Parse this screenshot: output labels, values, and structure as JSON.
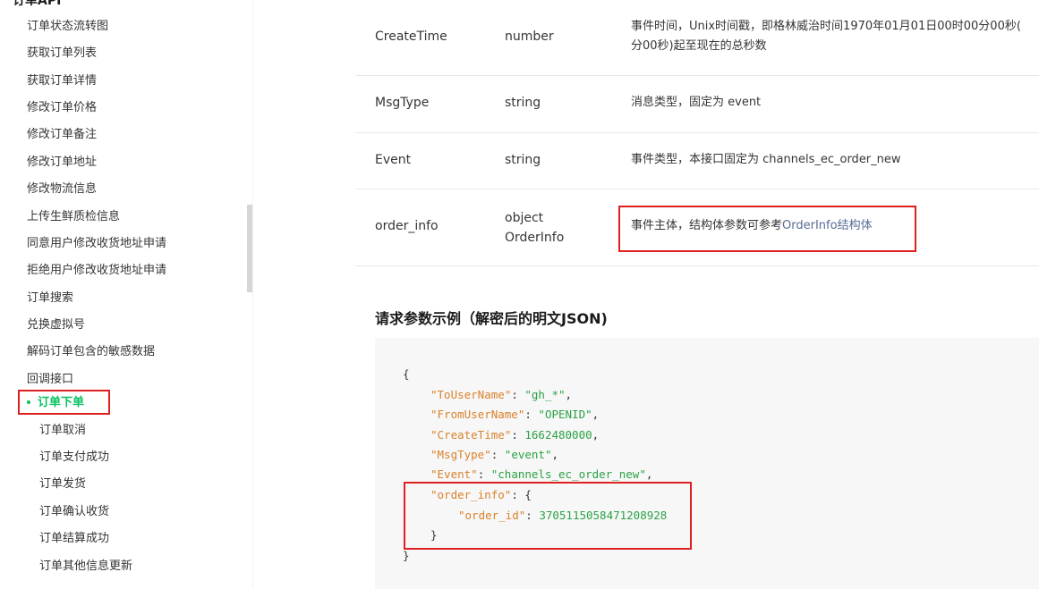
{
  "sidebar": {
    "heading": "订单API",
    "items": [
      {
        "label": "订单状态流转图"
      },
      {
        "label": "获取订单列表"
      },
      {
        "label": "获取订单详情"
      },
      {
        "label": "修改订单价格"
      },
      {
        "label": "修改订单备注"
      },
      {
        "label": "修改订单地址"
      },
      {
        "label": "修改物流信息"
      },
      {
        "label": "上传生鲜质检信息"
      },
      {
        "label": "同意用户修改收货地址申请"
      },
      {
        "label": "拒绝用户修改收货地址申请"
      },
      {
        "label": "订单搜索"
      },
      {
        "label": "兑换虚拟号"
      },
      {
        "label": "解码订单包含的敏感数据"
      },
      {
        "label": "回调接口"
      }
    ],
    "active_item": "订单下单",
    "sub_items": [
      {
        "label": "订单取消"
      },
      {
        "label": "订单支付成功"
      },
      {
        "label": "订单发货"
      },
      {
        "label": "订单确认收货"
      },
      {
        "label": "订单结算成功"
      },
      {
        "label": "订单其他信息更新"
      }
    ]
  },
  "params_table": {
    "rows": [
      {
        "name": "CreateTime",
        "type": "number",
        "desc_line1": "事件时间，Unix时间戳，即格林威治时间1970年01月01日00时00分00秒(",
        "desc_line2": "分00秒)起至现在的总秒数"
      },
      {
        "name": "MsgType",
        "type": "string",
        "desc": "消息类型，固定为 event"
      },
      {
        "name": "Event",
        "type": "string",
        "desc": "事件类型，本接口固定为 channels_ec_order_new"
      },
      {
        "name": "order_info",
        "type_line1": "object",
        "type_line2": "OrderInfo",
        "desc_prefix": "事件主体，结构体参数可参考",
        "desc_link": "OrderInfo结构体"
      }
    ]
  },
  "example": {
    "title": "请求参数示例（解密后的明文JSON)",
    "code": {
      "open": "{",
      "l1_key": "\"ToUserName\"",
      "l1_val": "\"gh_*\"",
      "l2_key": "\"FromUserName\"",
      "l2_val": "\"OPENID\"",
      "l3_key": "\"CreateTime\"",
      "l3_val": "1662480000",
      "l4_key": "\"MsgType\"",
      "l4_val": "\"event\"",
      "l5_key": "\"Event\"",
      "l5_val": "\"channels_ec_order_new\"",
      "l6_key": "\"order_info\"",
      "l7_key": "\"order_id\"",
      "l7_val": "3705115058471208928",
      "inner_close": "}",
      "close": "}"
    }
  },
  "colors": {
    "accent_green": "#07c160",
    "link_blue": "#576b95",
    "highlight_red": "#e02020",
    "json_key": "#d9822b",
    "json_value": "#2ba245"
  }
}
